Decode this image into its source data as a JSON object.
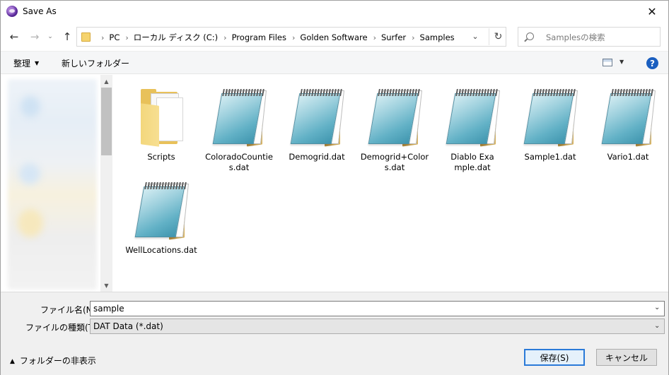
{
  "window": {
    "title": "Save As",
    "app_icon": "surfer-app-icon"
  },
  "address": {
    "crumbs": [
      "PC",
      "ローカル ディスク (C:)",
      "Program Files",
      "Golden Software",
      "Surfer",
      "Samples"
    ]
  },
  "search": {
    "placeholder": "Samplesの検索"
  },
  "toolbar": {
    "organize_label": "整理",
    "new_folder_label": "新しいフォルダー",
    "help_label": "?"
  },
  "files": [
    {
      "name": "Scripts",
      "type": "folder"
    },
    {
      "name": "ColoradoCounties.dat",
      "type": "dat"
    },
    {
      "name": "Demogrid.dat",
      "type": "dat"
    },
    {
      "name": "Demogrid+Colors.dat",
      "type": "dat"
    },
    {
      "name": "Diablo Example.dat",
      "type": "dat"
    },
    {
      "name": "Sample1.dat",
      "type": "dat"
    },
    {
      "name": "Vario1.dat",
      "type": "dat"
    },
    {
      "name": "WellLocations.dat",
      "type": "dat"
    }
  ],
  "form": {
    "file_name_label": "ファイル名(N):",
    "file_name_value": "sample",
    "file_type_label": "ファイルの種類(T):",
    "file_type_value": "DAT Data (*.dat)"
  },
  "footer": {
    "hide_folders_label": "フォルダーの非表示",
    "save_label": "保存(S)",
    "cancel_label": "キャンセル"
  },
  "colors": {
    "accent": "#2a7ad8",
    "help": "#1b5fc0",
    "folder": "#e8c15a"
  }
}
